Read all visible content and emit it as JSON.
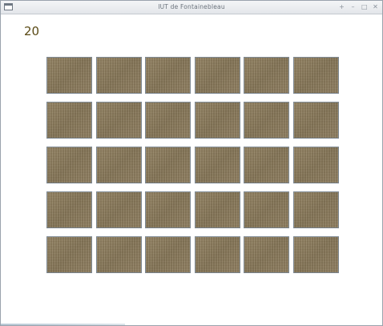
{
  "window": {
    "title": "IUT de Fontainebleau",
    "controls": {
      "pin": "+",
      "minimize": "–",
      "maximize": "□",
      "close": "✕"
    }
  },
  "game": {
    "score": "20",
    "board": {
      "rows": 5,
      "columns": 6,
      "card_state": "face-down",
      "card_color": "#8b7b5d"
    }
  }
}
